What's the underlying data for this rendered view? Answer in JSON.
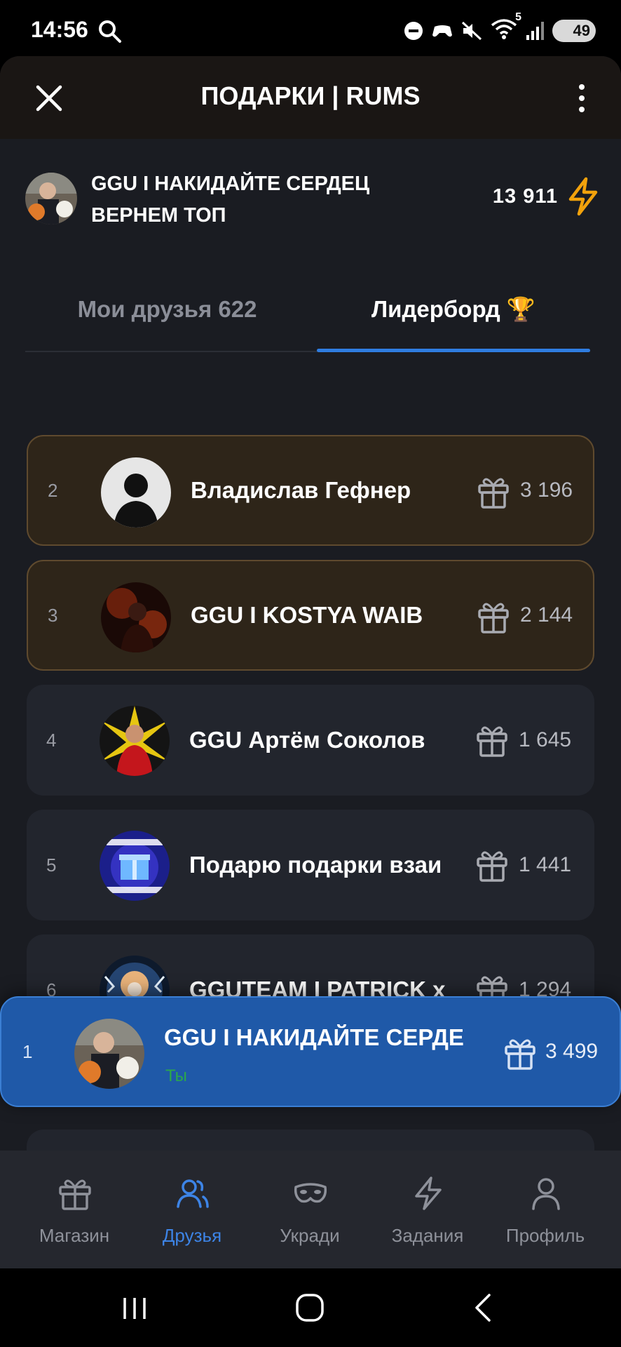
{
  "status_bar": {
    "time": "14:56",
    "battery": "49",
    "signal_badge": "5"
  },
  "app": {
    "title": "ПОДАРКИ | RUMS"
  },
  "profile": {
    "name": "GGU I НАКИДАЙТЕ СЕРДЕЦ ВЕРНЕМ ТОП",
    "score": "13 911"
  },
  "tabs": [
    {
      "label": "Мои друзья 622",
      "active": false
    },
    {
      "label": "Лидерборд 🏆",
      "active": true
    }
  ],
  "leaderboard": [
    {
      "rank": "2",
      "name": "Владислав Гефнер",
      "gifts": "3 196",
      "highlight": true
    },
    {
      "rank": "3",
      "name": "GGU I KOSTYA WAIB",
      "gifts": "2 144",
      "highlight": true
    },
    {
      "rank": "4",
      "name": "GGU Артём Соколов",
      "gifts": "1 645",
      "highlight": false
    },
    {
      "rank": "5",
      "name": "Подарю подарки взаи",
      "gifts": "1 441",
      "highlight": false
    },
    {
      "rank": "6",
      "name": "GGUTEAM I PATRICK x",
      "gifts": "1 294",
      "highlight": false
    }
  ],
  "pinned": {
    "rank": "1",
    "name": "GGU I НАКИДАЙТЕ СЕРДЕ",
    "subtitle": "Ты",
    "gifts": "3 499"
  },
  "bottom_nav": [
    {
      "label": "Магазин",
      "icon": "gift-icon",
      "active": false
    },
    {
      "label": "Друзья",
      "icon": "users-icon",
      "active": true
    },
    {
      "label": "Укради",
      "icon": "mask-icon",
      "active": false
    },
    {
      "label": "Задания",
      "icon": "bolt-icon",
      "active": false
    },
    {
      "label": "Профиль",
      "icon": "user-icon",
      "active": false
    }
  ],
  "colors": {
    "accent": "#2f7de1",
    "highlight_row_bg": "#2e2519",
    "highlight_row_border": "#5f4a2e",
    "pinned_bg": "#1f59a8",
    "bolt": "#f2a20c"
  }
}
